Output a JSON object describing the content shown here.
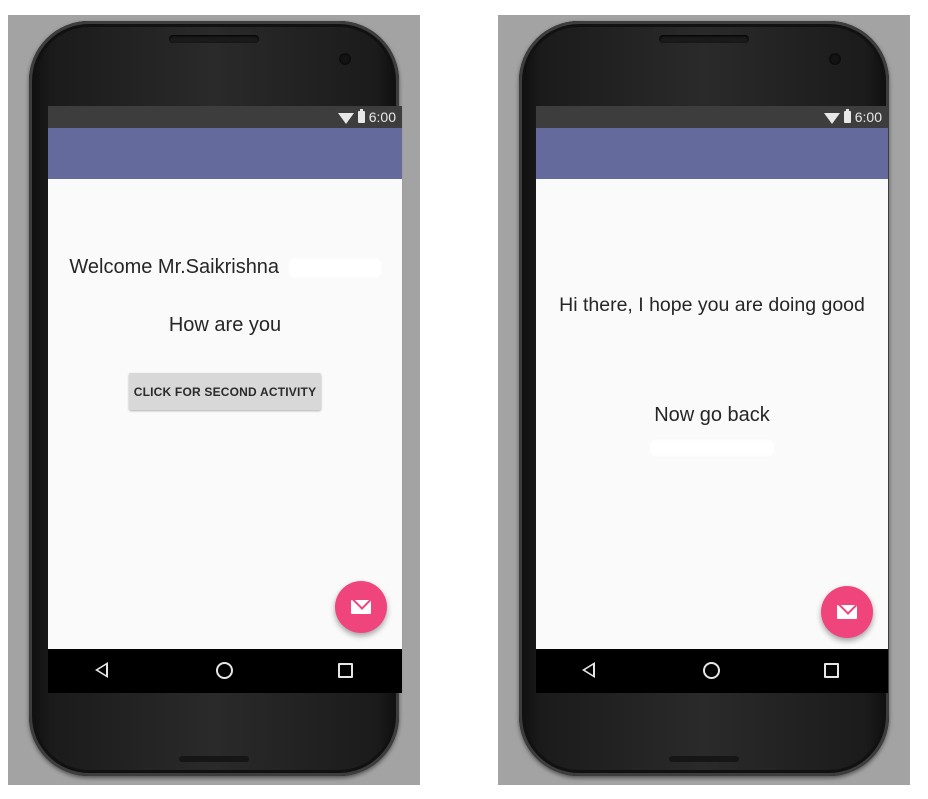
{
  "screens": [
    {
      "status": {
        "time": "6:00",
        "wifi_icon": "wifi-icon",
        "battery_icon": "battery-icon"
      },
      "app_bar_color": "#646a9c",
      "texts": [
        "Welcome Mr.Saikrishna",
        "How are you"
      ],
      "button_label": "CLICK FOR SECOND ACTIVITY",
      "fab": {
        "icon": "envelope-icon",
        "color": "#f0447d"
      },
      "nav": {
        "icons": [
          "back-icon",
          "home-icon",
          "recents-icon"
        ]
      }
    },
    {
      "status": {
        "time": "6:00",
        "wifi_icon": "wifi-icon",
        "battery_icon": "battery-icon"
      },
      "app_bar_color": "#646a9c",
      "texts": [
        "Hi there, I hope you are doing good",
        "Now go back"
      ],
      "fab": {
        "icon": "envelope-icon",
        "color": "#f0447d"
      },
      "nav": {
        "icons": [
          "back-icon",
          "home-icon",
          "recents-icon"
        ]
      }
    }
  ]
}
